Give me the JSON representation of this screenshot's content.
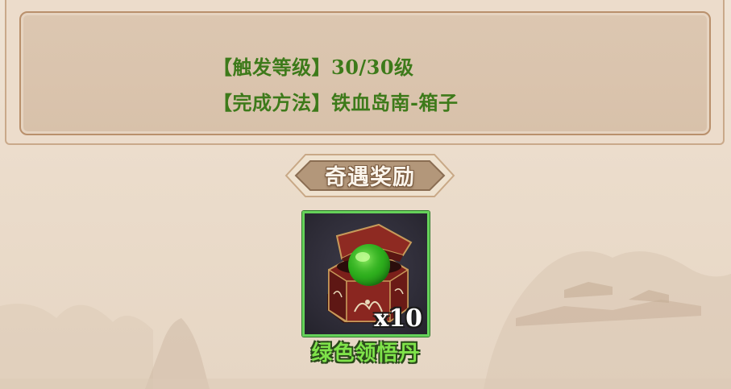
{
  "info": {
    "trigger_level_line": "【触发等级】30/30级",
    "method_line": "【完成方法】铁血岛南-箱子"
  },
  "reward_section": {
    "title": "奇遇奖励"
  },
  "reward_item": {
    "name": "绿色领悟丹",
    "quantity": "x10",
    "icon": "chest-icon",
    "rarity_color": "#66d25a"
  }
}
